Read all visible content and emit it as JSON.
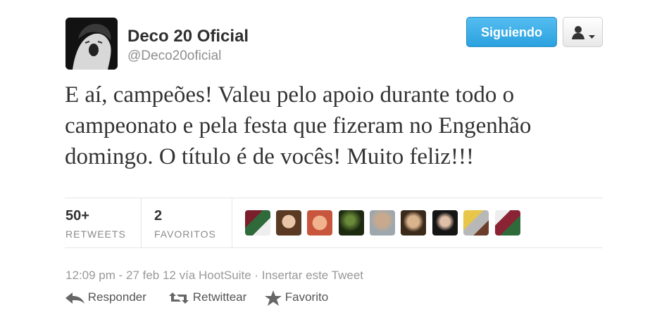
{
  "user": {
    "display_name": "Deco 20 Oficial",
    "handle": "@Deco20oficial"
  },
  "buttons": {
    "follow_label": "Siguiendo"
  },
  "tweet": {
    "text": "E aí, campeões! Valeu pelo apoio durante todo o campeonato e pela festa que fizeram no Engenhão domingo. O título é de vocês! Muito feliz!!!"
  },
  "stats": {
    "retweets_count": "50+",
    "retweets_label": "RETWEETS",
    "favorites_count": "2",
    "favorites_label": "FAVORITOS"
  },
  "meta": {
    "line": "12:09 pm - 27 feb 12 vía HootSuite · Insertar este Tweet"
  },
  "actions": {
    "reply": "Responder",
    "retweet": "Retwittear",
    "favorite": "Favorito"
  },
  "colors": {
    "accent": "#2aa1df",
    "muted": "#999999"
  },
  "icons": {
    "user_menu": "person-icon",
    "reply": "reply-arrow-icon",
    "retweet": "retweet-icon",
    "favorite": "star-icon"
  }
}
